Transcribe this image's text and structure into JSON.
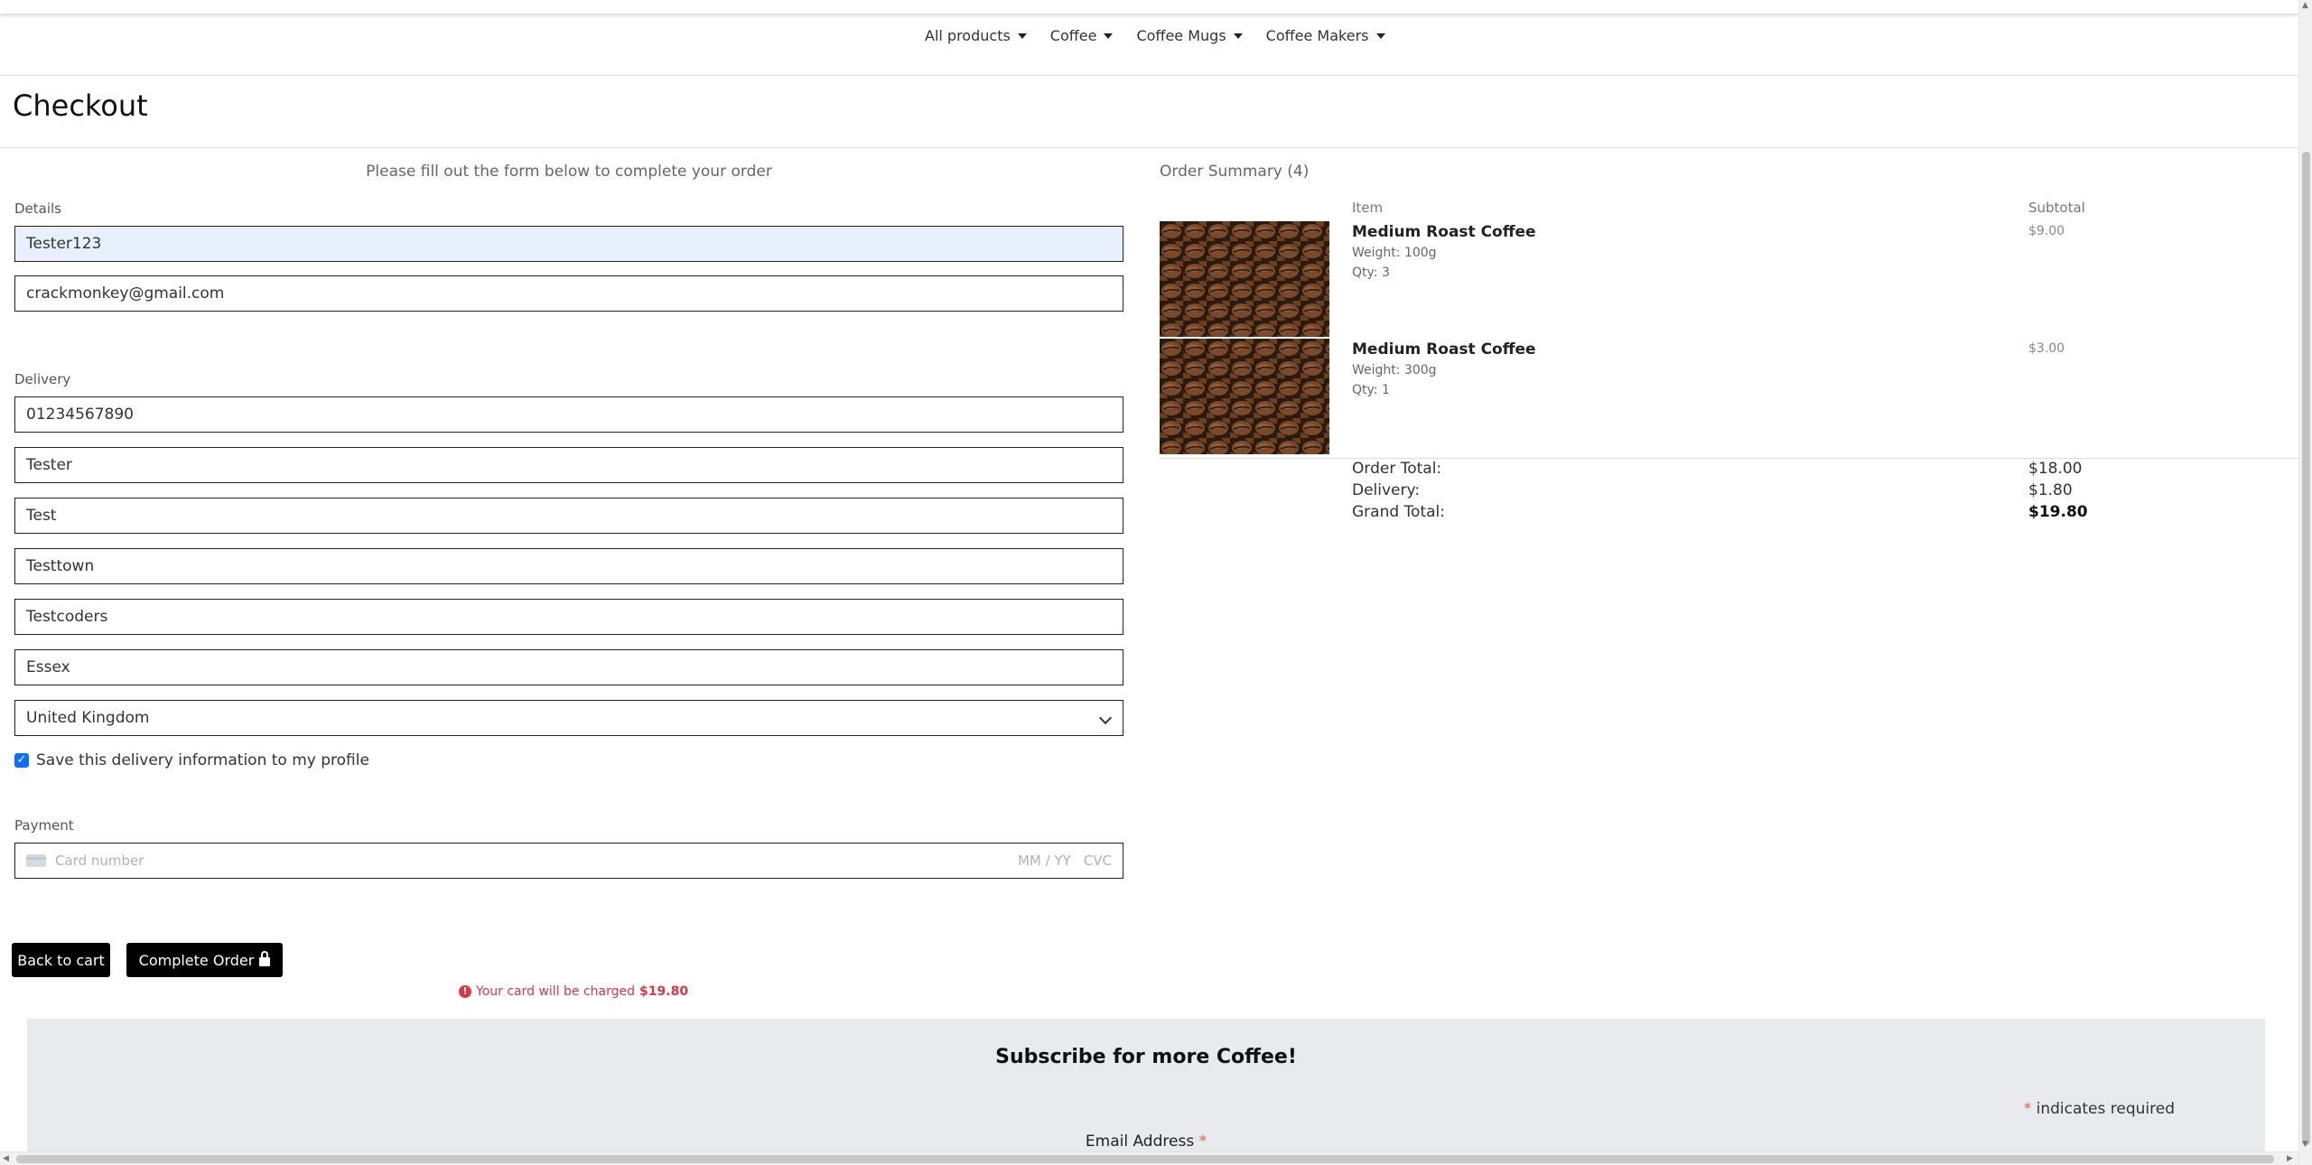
{
  "nav": {
    "items": [
      {
        "label": "All products"
      },
      {
        "label": "Coffee"
      },
      {
        "label": "Coffee Mugs"
      },
      {
        "label": "Coffee Makers"
      }
    ]
  },
  "page": {
    "title": "Checkout"
  },
  "form": {
    "intro": "Please fill out the form below to complete your order",
    "details_label": "Details",
    "full_name": "Tester123",
    "email": "crackmonkey@gmail.com",
    "delivery_label": "Delivery",
    "phone": "01234567890",
    "street1": "Tester",
    "street2": "Test",
    "town": "Testtown",
    "postcode": "Testcoders",
    "county": "Essex",
    "country": "United Kingdom",
    "save_info_label": "Save this delivery information to my profile",
    "payment_label": "Payment",
    "card_placeholder": "Card number",
    "expiry_placeholder": "MM / YY",
    "cvc_placeholder": "CVC"
  },
  "buttons": {
    "back": "Back to cart",
    "complete": "Complete Order"
  },
  "charge": {
    "text": "Your card will be charged",
    "amount": "$19.80"
  },
  "summary": {
    "title": "Order Summary (4)",
    "col_item": "Item",
    "col_subtotal": "Subtotal",
    "items": [
      {
        "name": "Medium Roast Coffee",
        "weight": "Weight: 100g",
        "qty": "Qty: 3",
        "subtotal": "$9.00"
      },
      {
        "name": "Medium Roast Coffee",
        "weight": "Weight: 300g",
        "qty": "Qty: 1",
        "subtotal": "$3.00"
      }
    ],
    "order_total_label": "Order Total:",
    "order_total": "$18.00",
    "delivery_label": "Delivery:",
    "delivery": "$1.80",
    "grand_total_label": "Grand Total:",
    "grand_total": "$19.80"
  },
  "subscribe": {
    "title": "Subscribe for more Coffee!",
    "required_note": "indicates required",
    "email_label": "Email Address"
  },
  "colors": {
    "accent_red": "#dc3545",
    "button": "#000000",
    "autofill": "#e8f0fe"
  }
}
